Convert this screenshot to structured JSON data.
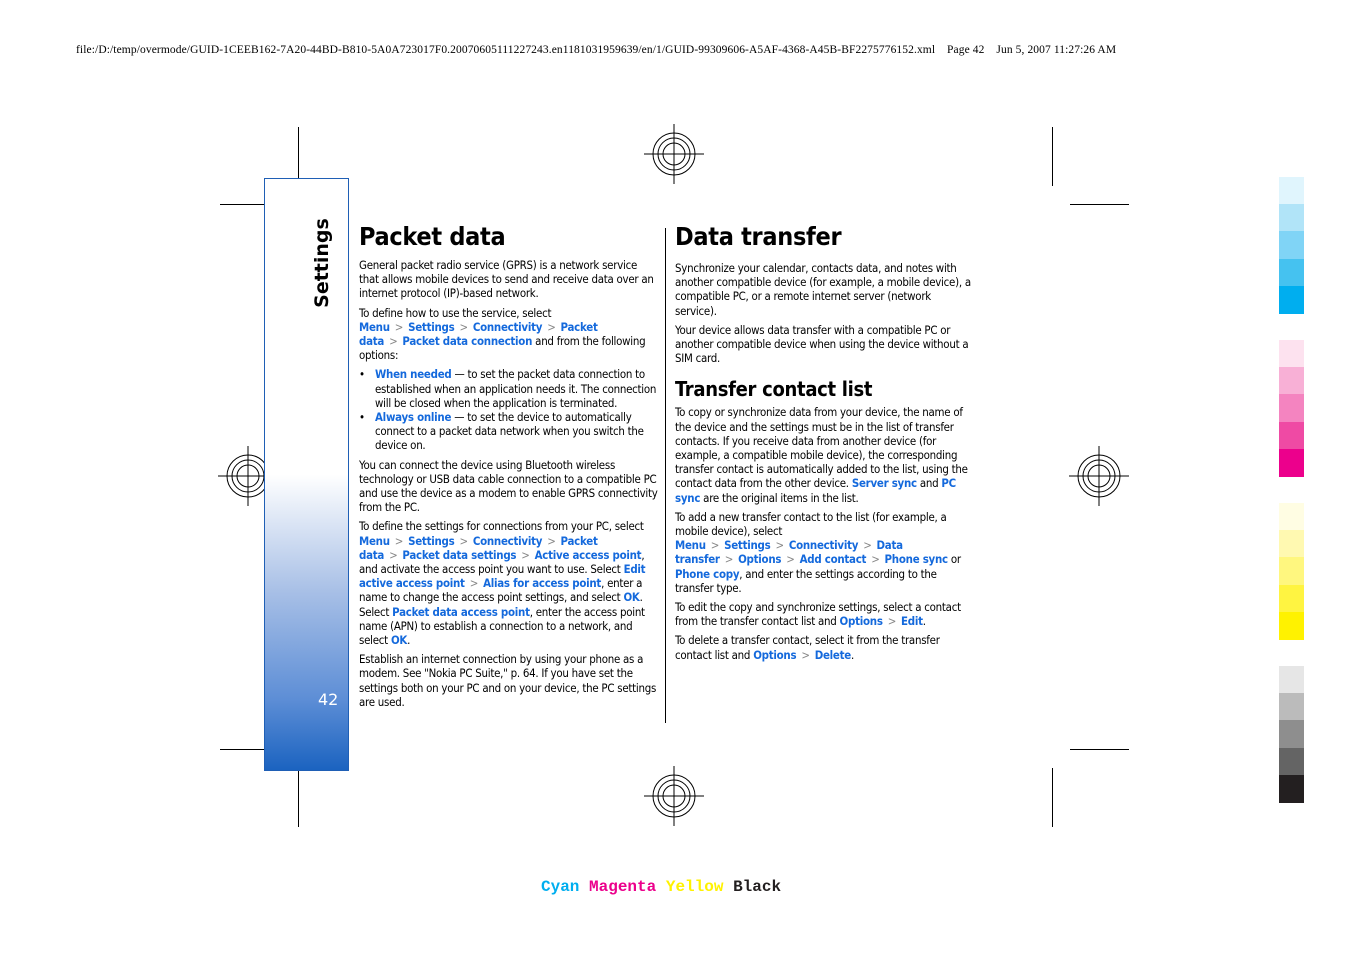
{
  "print_header": {
    "file_path": "file:/D:/temp/overmode/GUID-1CEEB162-7A20-44BD-B810-5A0A723017F0.20070605111227243.en1181031959639/en/1/GUID-99309606-A5AF-4368-A45B-BF2275776152.xml",
    "page_label": "Page 42",
    "timestamp": "Jun 5, 2007 11:27:26 AM"
  },
  "side_tab": {
    "label": "Settings",
    "page_number": "42"
  },
  "packet_data": {
    "title": "Packet data",
    "intro": "General packet radio service (GPRS) is a network service that allows mobile devices to send and receive data over an internet protocol (IP)-based network.",
    "define_prefix": "To define how to use the service, select ",
    "define_path": [
      "Menu",
      "Settings",
      "Connectivity",
      "Packet data",
      "Packet data connection"
    ],
    "define_suffix": " and from the following options:",
    "options": [
      {
        "name": "When needed",
        "desc": " — to set the packet data connection to established when an application needs it. The connection will be closed when the application is terminated."
      },
      {
        "name": "Always online",
        "desc": " — to set the device to automatically connect to a packet data network when you switch the device on."
      }
    ],
    "bluetooth_para": "You can connect the device using Bluetooth wireless technology or USB data cable connection to a compatible PC and use the device as a modem to enable GPRS connectivity from the PC.",
    "pc_settings": {
      "prefix": "To define the settings for connections from your PC, select ",
      "path1": [
        "Menu",
        "Settings",
        "Connectivity",
        "Packet data",
        "Packet data settings",
        "Active access point"
      ],
      "mid1": ", and activate the access point you want to use. Select ",
      "path2": [
        "Edit active access point",
        "Alias for access point"
      ],
      "mid2": ", enter a name to change the access point settings, and select ",
      "ok1": "OK",
      "mid3": ". Select ",
      "apn_link": "Packet data access point",
      "mid4": ", enter the access point name (APN) to establish a connection to a network, and select ",
      "ok2": "OK",
      "end": "."
    },
    "modem_para": "Establish an internet connection by using your phone as a modem. See \"Nokia PC Suite,\" p. 64. If you have set the settings both on your PC and on your device, the PC settings are used."
  },
  "data_transfer": {
    "title": "Data transfer",
    "intro": "Synchronize your calendar, contacts data, and notes with another compatible device (for example, a mobile device), a compatible PC, or a remote internet server (network service).",
    "sim_para": "Your device allows data transfer with a compatible PC or another compatible device when using the device without a SIM card.",
    "contact_list": {
      "title": "Transfer contact list",
      "para1": "To copy or synchronize data from your device, the name of the device and the settings must be in the list of transfer contacts. If you receive data from another device (for example, a compatible mobile device), the corresponding transfer contact is automatically added to the list, using the contact data from the other device. ",
      "server_sync": "Server sync",
      "and": " and ",
      "pc_sync": "PC sync",
      "para1_end": " are the original items in the list.",
      "add_prefix": "To add a new transfer contact to the list (for example, a mobile device), select ",
      "add_path": [
        "Menu",
        "Settings",
        "Connectivity",
        "Data transfer",
        "Options",
        "Add contact",
        "Phone sync"
      ],
      "or": " or ",
      "phone_copy": "Phone copy",
      "add_suffix": ", and enter the settings according to the transfer type.",
      "edit_prefix": "To edit the copy and synchronize settings, select a contact from the transfer contact list and ",
      "edit_path": [
        "Options",
        "Edit"
      ],
      "delete_prefix": "To delete a transfer contact, select it from the transfer contact list and ",
      "delete_path": [
        "Options",
        "Delete"
      ],
      "period": "."
    }
  },
  "color_bar": {
    "cyan": "Cyan",
    "magenta": "Magenta",
    "yellow": "Yellow",
    "black": "Black",
    "colors": {
      "cyan": "#00aeef",
      "magenta": "#ec008c",
      "yellow": "#fff200",
      "black": "#231f20",
      "link": "#1469dc",
      "tab": "#1b63c0"
    }
  },
  "swatches": {
    "cyan": [
      "#e0f5fd",
      "#b1e4f8",
      "#80d4f6",
      "#45c2f0",
      "#00aeef"
    ],
    "magenta": [
      "#fde2ef",
      "#f8b0d6",
      "#f484c0",
      "#ef4aa4",
      "#ec008c"
    ],
    "yellow": [
      "#fffde3",
      "#fff9b1",
      "#fff77f",
      "#fff441",
      "#fff200"
    ],
    "black": [
      "#e6e6e6",
      "#bbbbbb",
      "#8e8e8e",
      "#646464",
      "#231f20"
    ]
  }
}
